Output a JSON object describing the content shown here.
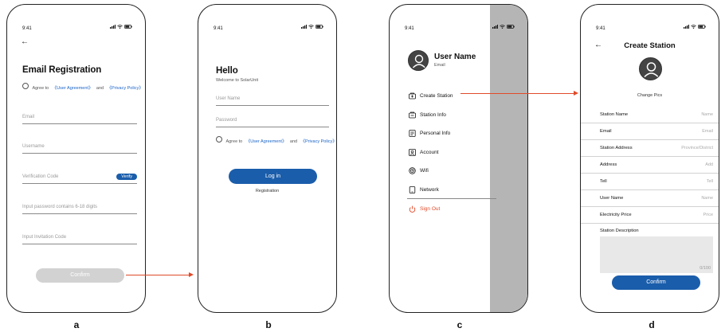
{
  "status_bar": {
    "time": "9:41"
  },
  "panel_labels": [
    "a",
    "b",
    "c",
    "d"
  ],
  "panel_a": {
    "title": "Email Registration",
    "agree_prefix": "Agree to",
    "user_agreement": "《User Agreement》",
    "and": "and",
    "privacy_policy": "《Privacy Policy》",
    "fields": [
      {
        "placeholder": "Email"
      },
      {
        "placeholder": "Username"
      },
      {
        "placeholder": "Verification Code"
      },
      {
        "placeholder": "Input password contains 6-18 digits"
      },
      {
        "placeholder": "Input Invitation Code"
      }
    ],
    "verify_label": "Verify",
    "confirm_label": "Confirm"
  },
  "panel_b": {
    "title": "Hello",
    "subtitle": "Welcome to SolarUnit",
    "fields": [
      {
        "placeholder": "User Name"
      },
      {
        "placeholder": "Password"
      }
    ],
    "agree_prefix": "Agree to",
    "user_agreement": "《User Agreement》",
    "and": "and",
    "privacy_policy": "《Privacy Policy》",
    "login_label": "Log in",
    "registration_label": "Registration"
  },
  "panel_c": {
    "user_name": "User Name",
    "user_email": "Email",
    "menu": [
      {
        "label": "Create Station",
        "icon": "create-station-icon"
      },
      {
        "label": "Station Info",
        "icon": "station-info-icon"
      },
      {
        "label": "Personal Info",
        "icon": "personal-info-icon"
      },
      {
        "label": "Account",
        "icon": "account-icon"
      },
      {
        "label": "Wifi",
        "icon": "wifi-icon"
      },
      {
        "label": "Network",
        "icon": "network-icon"
      }
    ],
    "sign_out": "Sign Out",
    "sign_out_color": "#e04b2a"
  },
  "panel_d": {
    "title": "Create Station",
    "change_pics": "Change Pics",
    "rows": [
      {
        "label": "Station Name",
        "hint": "Name"
      },
      {
        "label": "Email",
        "hint": "Email"
      },
      {
        "label": "Station Address",
        "hint": "Province/District"
      },
      {
        "label": "Address",
        "hint": "Add"
      },
      {
        "label": "Tell",
        "hint": "Tell"
      },
      {
        "label": "User Name",
        "hint": "Name"
      },
      {
        "label": "Electricity Price",
        "hint": "Price"
      }
    ],
    "description_label": "Station Description",
    "char_count": "0/100",
    "confirm_label": "Confirm"
  },
  "colors": {
    "accent_blue": "#1a5dab",
    "link_blue": "#1a64c8",
    "arrow_red": "#e04b2a",
    "drawer_overlay": "#b5b5b5"
  }
}
